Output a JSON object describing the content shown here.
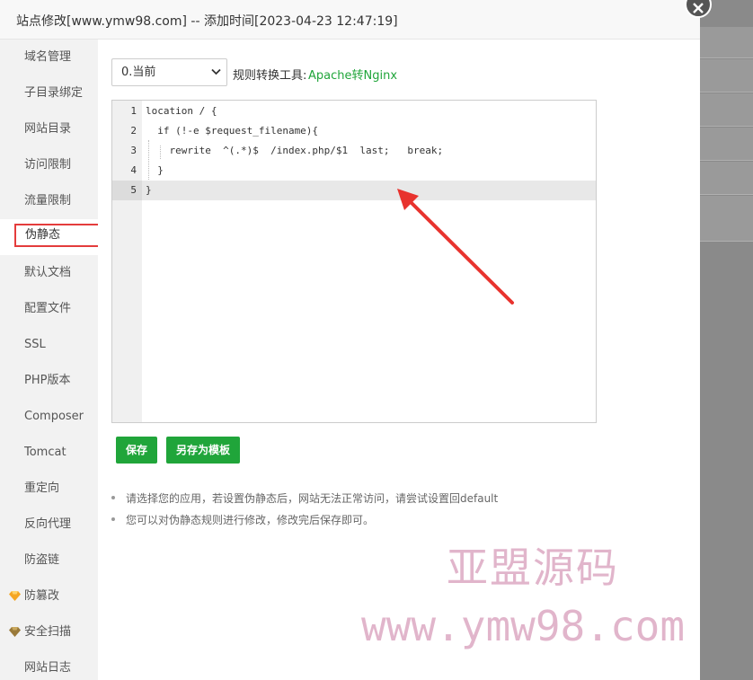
{
  "dialog": {
    "title": "站点修改[www.ymw98.com] -- 添加时间[2023-04-23 12:47:19]"
  },
  "sidebar": {
    "items": [
      {
        "label": "域名管理"
      },
      {
        "label": "子目录绑定"
      },
      {
        "label": "网站目录"
      },
      {
        "label": "访问限制"
      },
      {
        "label": "流量限制"
      },
      {
        "label": "伪静态",
        "active": true
      },
      {
        "label": "默认文档"
      },
      {
        "label": "配置文件"
      },
      {
        "label": "SSL"
      },
      {
        "label": "PHP版本"
      },
      {
        "label": "Composer"
      },
      {
        "label": "Tomcat"
      },
      {
        "label": "重定向"
      },
      {
        "label": "反向代理"
      },
      {
        "label": "防盗链"
      },
      {
        "label": "防篡改",
        "icon": "gem-icon"
      },
      {
        "label": "安全扫描",
        "icon": "gem-icon"
      },
      {
        "label": "网站日志"
      }
    ]
  },
  "rewrite": {
    "version_select": "0.当前",
    "tool_label": "规则转换工具:",
    "tool_link": "Apache转Nginx",
    "code_lines": [
      {
        "no": "1",
        "text": "location / {"
      },
      {
        "no": "2",
        "text": "  if (!-e $request_filename){"
      },
      {
        "no": "3",
        "text": "    rewrite  ^(.*)$  /index.php/$1  last;   break;"
      },
      {
        "no": "4",
        "text": "  }"
      },
      {
        "no": "5",
        "text": "}"
      }
    ],
    "save_label": "保存",
    "save_template_label": "另存为模板",
    "tips": [
      "请选择您的应用，若设置伪静态后，网站无法正常访问，请尝试设置回default",
      "您可以对伪静态规则进行修改，修改完后保存即可。"
    ]
  },
  "watermark": {
    "cn": "亚盟源码",
    "url": "www.ymw98.com"
  },
  "colors": {
    "accent": "#20a53a",
    "highlight_box": "#e43c3c",
    "arrow": "#e8332e"
  }
}
